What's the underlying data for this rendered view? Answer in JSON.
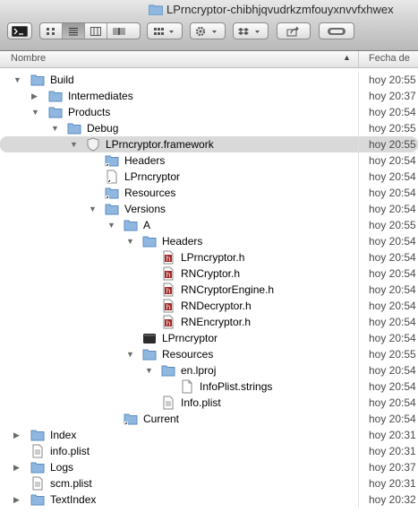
{
  "window": {
    "title": "LPrncryptor-chibhjqvudrkzmfouyxnvvfxhwex"
  },
  "toolbar": {
    "back_icon": "terminal-icon",
    "view_modes": [
      "icon-view-icon",
      "list-view-icon",
      "column-view-icon",
      "coverflow-view-icon"
    ],
    "arrange_icon": "arrange-icon",
    "action_icon": "gear-icon",
    "dropbox_icon": "dropbox-icon",
    "share_icon": "share-icon",
    "tag_icon": "tag-icon"
  },
  "columns": {
    "name": "Nombre",
    "date": "Fecha de"
  },
  "rows": [
    {
      "label": "Build",
      "date": "hoy 20:55"
    },
    {
      "label": "Intermediates",
      "date": "hoy 20:37"
    },
    {
      "label": "Products",
      "date": "hoy 20:54"
    },
    {
      "label": "Debug",
      "date": "hoy 20:55"
    },
    {
      "label": "LPrncryptor.framework",
      "date": "hoy 20:55"
    },
    {
      "label": "Headers",
      "date": "hoy 20:54"
    },
    {
      "label": "LPrncryptor",
      "date": "hoy 20:54"
    },
    {
      "label": "Resources",
      "date": "hoy 20:54"
    },
    {
      "label": "Versions",
      "date": "hoy 20:54"
    },
    {
      "label": "A",
      "date": "hoy 20:55"
    },
    {
      "label": "Headers",
      "date": "hoy 20:54"
    },
    {
      "label": "LPrncryptor.h",
      "date": "hoy 20:54"
    },
    {
      "label": "RNCryptor.h",
      "date": "hoy 20:54"
    },
    {
      "label": "RNCryptorEngine.h",
      "date": "hoy 20:54"
    },
    {
      "label": "RNDecryptor.h",
      "date": "hoy 20:54"
    },
    {
      "label": "RNEncryptor.h",
      "date": "hoy 20:54"
    },
    {
      "label": "LPrncryptor",
      "date": "hoy 20:54"
    },
    {
      "label": "Resources",
      "date": "hoy 20:55"
    },
    {
      "label": "en.lproj",
      "date": "hoy 20:54"
    },
    {
      "label": "InfoPlist.strings",
      "date": "hoy 20:54"
    },
    {
      "label": "Info.plist",
      "date": "hoy 20:54"
    },
    {
      "label": "Current",
      "date": "hoy 20:54"
    },
    {
      "label": "Index",
      "date": "hoy 20:31"
    },
    {
      "label": "info.plist",
      "date": "hoy 20:31"
    },
    {
      "label": "Logs",
      "date": "hoy 20:37"
    },
    {
      "label": "scm.plist",
      "date": "hoy 20:31"
    },
    {
      "label": "TextIndex",
      "date": "hoy 20:32"
    }
  ]
}
